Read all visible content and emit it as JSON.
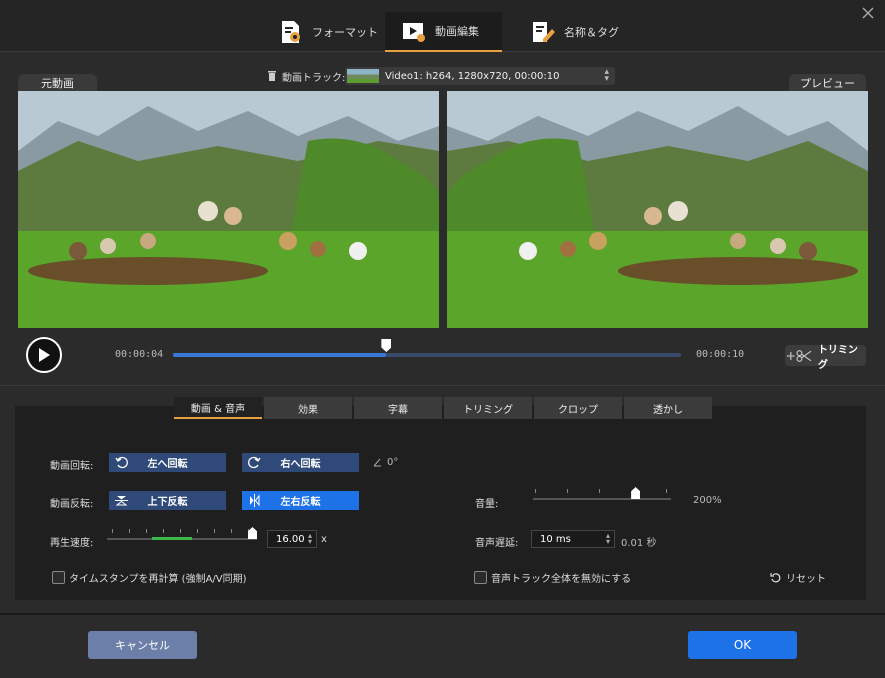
{
  "top_tabs": [
    {
      "label": "フォーマット",
      "icon": "format-settings-icon"
    },
    {
      "label": "動画編集",
      "icon": "video-edit-icon"
    },
    {
      "label": "名称＆タグ",
      "icon": "edit-tag-icon"
    }
  ],
  "video": {
    "original_label": "元動画",
    "preview_label": "プレビュー",
    "track_label": "動画トラック:",
    "track_value": "Video1: h264, 1280x720, 00:00:10"
  },
  "playback": {
    "current_time": "00:00:04",
    "total_time": "00:00:10",
    "progress": 0.42,
    "trim_label": "トリミング"
  },
  "sub_tabs": [
    "動画 & 音声",
    "効果",
    "字幕",
    "トリミング",
    "クロップ",
    "透かし"
  ],
  "rotate": {
    "label": "動画回転:",
    "left": "左へ回転",
    "right": "右へ回転",
    "angle": "0°"
  },
  "flip": {
    "label": "動画反転:",
    "vertical": "上下反転",
    "horizontal": "左右反転"
  },
  "speed": {
    "label": "再生速度:",
    "value": "16.00",
    "unit": "x",
    "level": 1.0
  },
  "volume": {
    "label": "音量:",
    "value": "200%",
    "level": 0.74
  },
  "audio_delay": {
    "label": "音声遅延:",
    "value": "10 ms",
    "extra": "0.01 秒"
  },
  "checkboxes": {
    "timestamp": "タイムスタンプを再計算 (強制A/V同期)",
    "disable_audio": "音声トラック全体を無効にする"
  },
  "reset_label": "リセット",
  "footer": {
    "cancel": "キャンセル",
    "ok": "OK"
  },
  "colors": {
    "accent": "#1e72e8",
    "tab_underline": "#e8a040",
    "speed_fill": "#3cb84a"
  }
}
